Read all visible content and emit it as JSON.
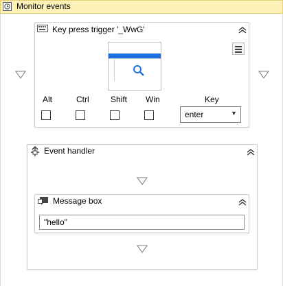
{
  "header": {
    "title": "Monitor events",
    "icon": "monitor-events-icon"
  },
  "key_trigger": {
    "title": "Key press trigger '_WwG'",
    "modifiers": [
      {
        "label": "Alt",
        "checked": false
      },
      {
        "label": "Ctrl",
        "checked": false
      },
      {
        "label": "Shift",
        "checked": false
      },
      {
        "label": "Win",
        "checked": false
      }
    ],
    "key_label": "Key",
    "key_value": "enter",
    "accent_color": "#1e6fe0"
  },
  "event_handler": {
    "title": "Event handler",
    "message_box": {
      "title": "Message box",
      "text_value": "\"hello\""
    }
  }
}
